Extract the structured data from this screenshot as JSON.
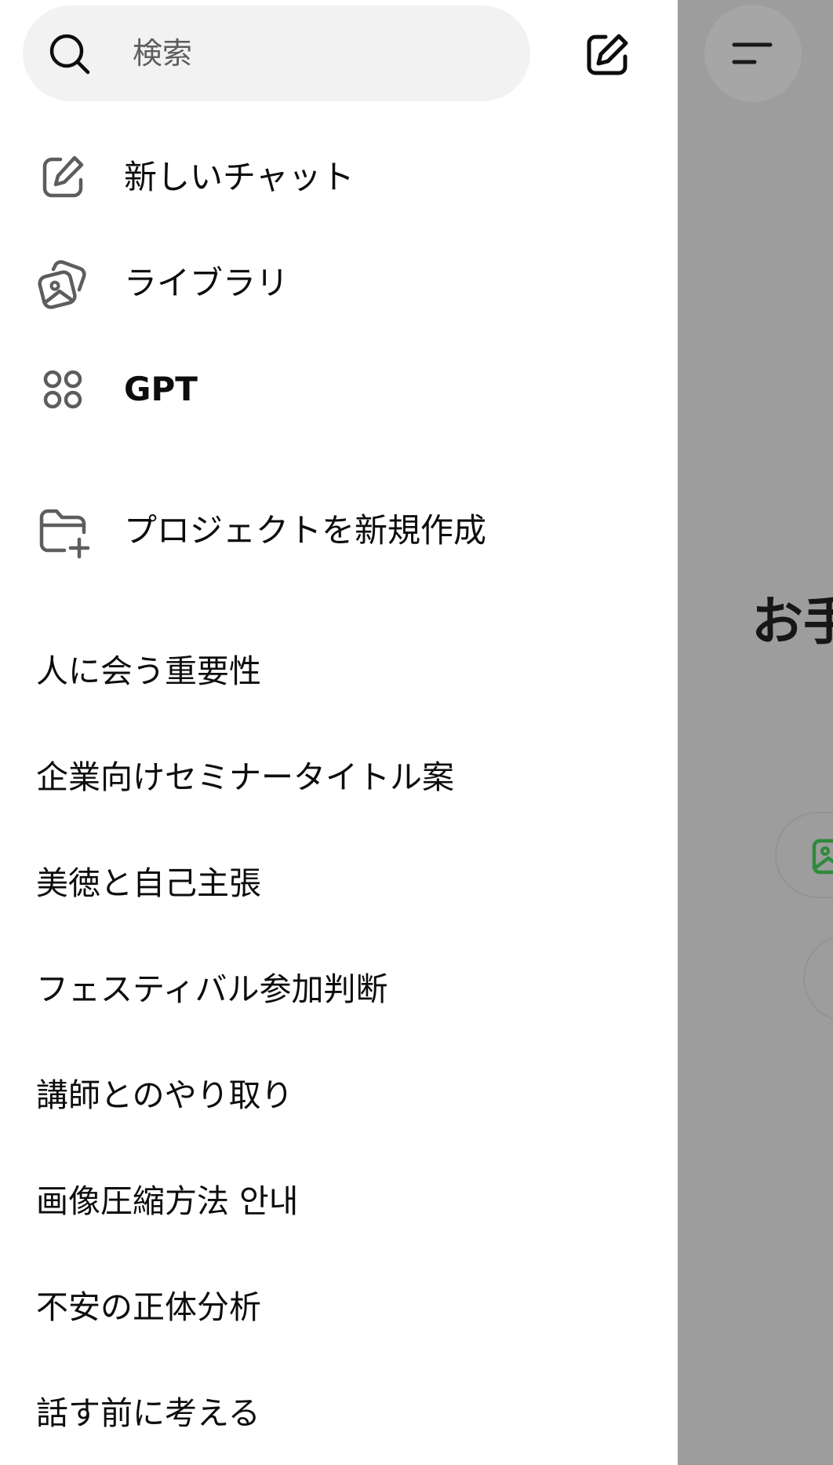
{
  "search": {
    "placeholder": "検索"
  },
  "nav": {
    "new_chat": "新しいチャット",
    "library": "ライブラリ",
    "gpt": "GPT",
    "new_project": "プロジェクトを新規作成"
  },
  "history": [
    "人に会う重要性",
    "企業向けセミナータイトル案",
    "美徳と自己主張",
    "フェスティバル参加判断",
    "講師とのやり取り",
    "画像圧縮方法 안내",
    "不安の正体分析",
    "話す前に考える"
  ],
  "background": {
    "greeting": "お手"
  },
  "icons": {
    "search": "search-icon",
    "compose": "compose-icon",
    "new_chat": "edit-icon",
    "library": "images-icon",
    "gpt": "grid-dots-icon",
    "new_project": "folder-plus-icon",
    "menu": "menu-icon",
    "image_chip": "image-icon"
  },
  "colors": {
    "drawer_bg": "#ffffff",
    "search_bg": "#f2f2f2",
    "overlay": "#9d9d9d",
    "chip_icon": "#2f8a3c"
  }
}
